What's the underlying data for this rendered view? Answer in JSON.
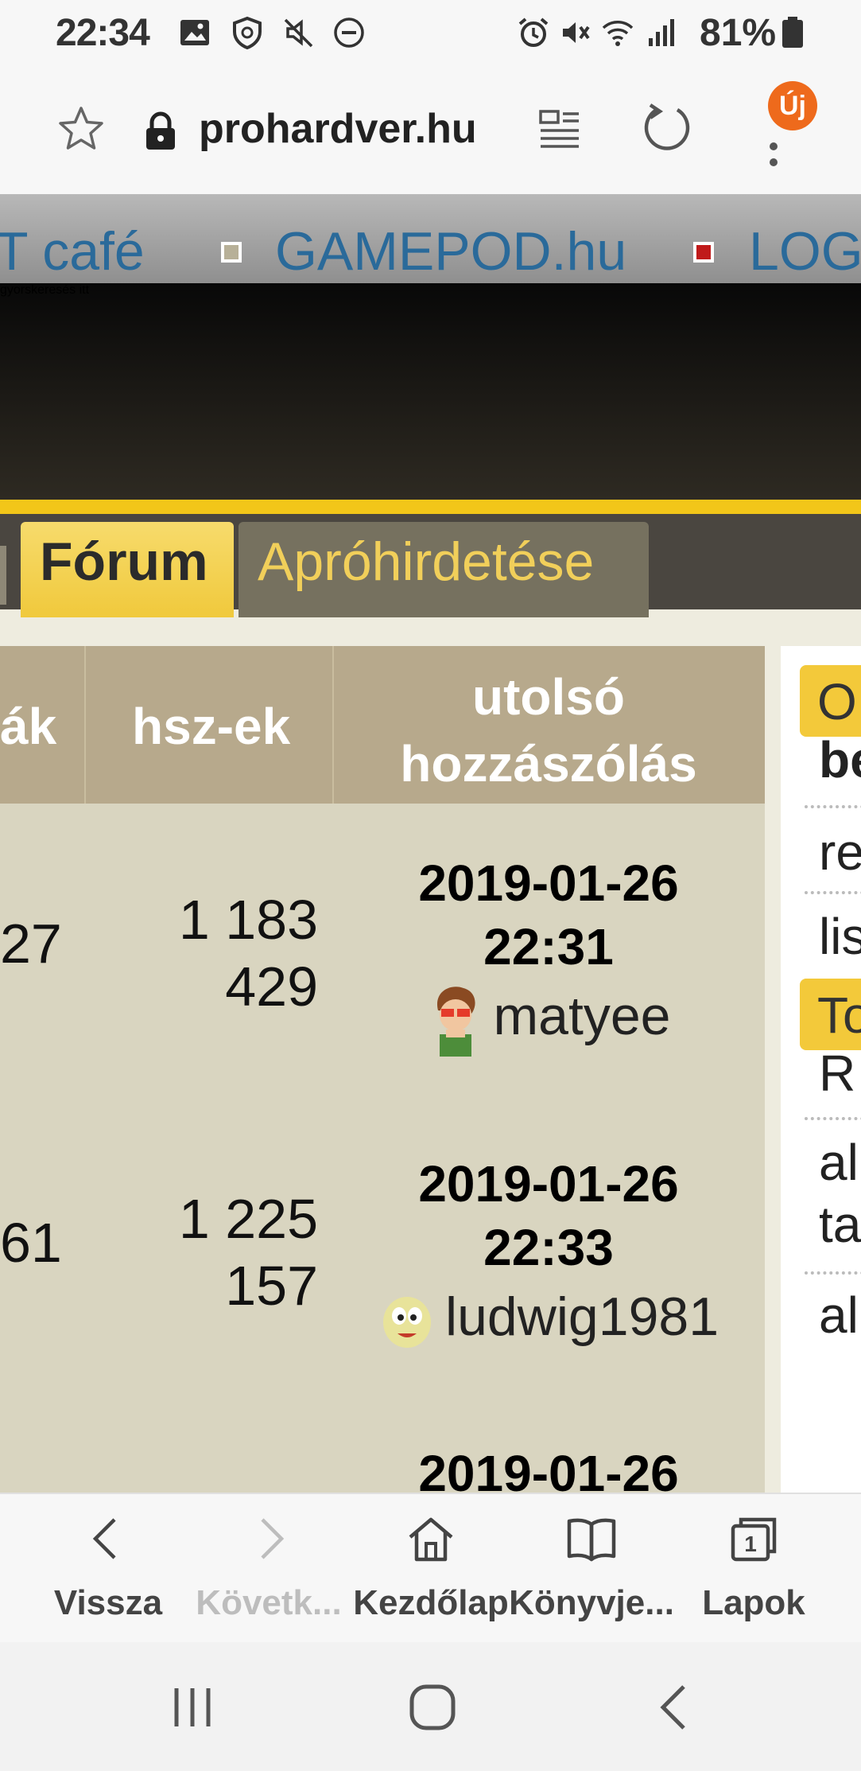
{
  "status_bar": {
    "time": "22:34",
    "battery": "81%",
    "left_icons": [
      "image-icon",
      "shield-icon",
      "mute-icon",
      "dnd-icon"
    ],
    "right_icons": [
      "alarm-icon",
      "vibrate-icon",
      "wifi-icon",
      "signal-icon",
      "battery-icon"
    ]
  },
  "browser": {
    "url": "prohardver.hu",
    "new_badge": "Új"
  },
  "site": {
    "top_links": [
      "T café",
      "GAMEPOD.hu",
      "LOG"
    ],
    "search_placeholder": "gyorskeresés itt",
    "tabs": [
      "Fórum",
      "Apróhirdetése"
    ]
  },
  "forum_table": {
    "headers": [
      "ák",
      "hsz-ek",
      "utolsó hozzászólás"
    ],
    "rows": [
      {
        "topics": "27",
        "posts_line1": "1 183",
        "posts_line2": "429",
        "date": "2019-01-26",
        "time": "22:31",
        "user": "matyee"
      },
      {
        "topics": "61",
        "posts_line1": "1 225",
        "posts_line2": "157",
        "date": "2019-01-26",
        "time": "22:33",
        "user": "ludwig1981"
      },
      {
        "topics": "",
        "posts_line1": "",
        "posts_line2": "",
        "date": "2019-01-26",
        "time": "",
        "user": ""
      }
    ]
  },
  "right_column": {
    "tag1": "O",
    "item_bold": "be",
    "items1": [
      "re",
      "lis"
    ],
    "tag2": "To",
    "items2": [
      "R",
      "al",
      "ta",
      "al"
    ]
  },
  "toolbar": {
    "buttons": [
      {
        "label": "Vissza",
        "icon": "back-icon"
      },
      {
        "label": "Követk...",
        "icon": "forward-icon"
      },
      {
        "label": "Kezdőlap",
        "icon": "home-icon"
      },
      {
        "label": "Könyvje...",
        "icon": "bookmarks-icon"
      },
      {
        "label": "Lapok",
        "icon": "tabs-icon"
      }
    ],
    "tab_count": "1"
  },
  "colors": {
    "accent_yellow": "#f2c619",
    "link_blue": "#2a6a9a",
    "table_bg": "#d9d5c0",
    "table_header": "#b7a98c",
    "badge_orange": "#ee6a1c"
  }
}
